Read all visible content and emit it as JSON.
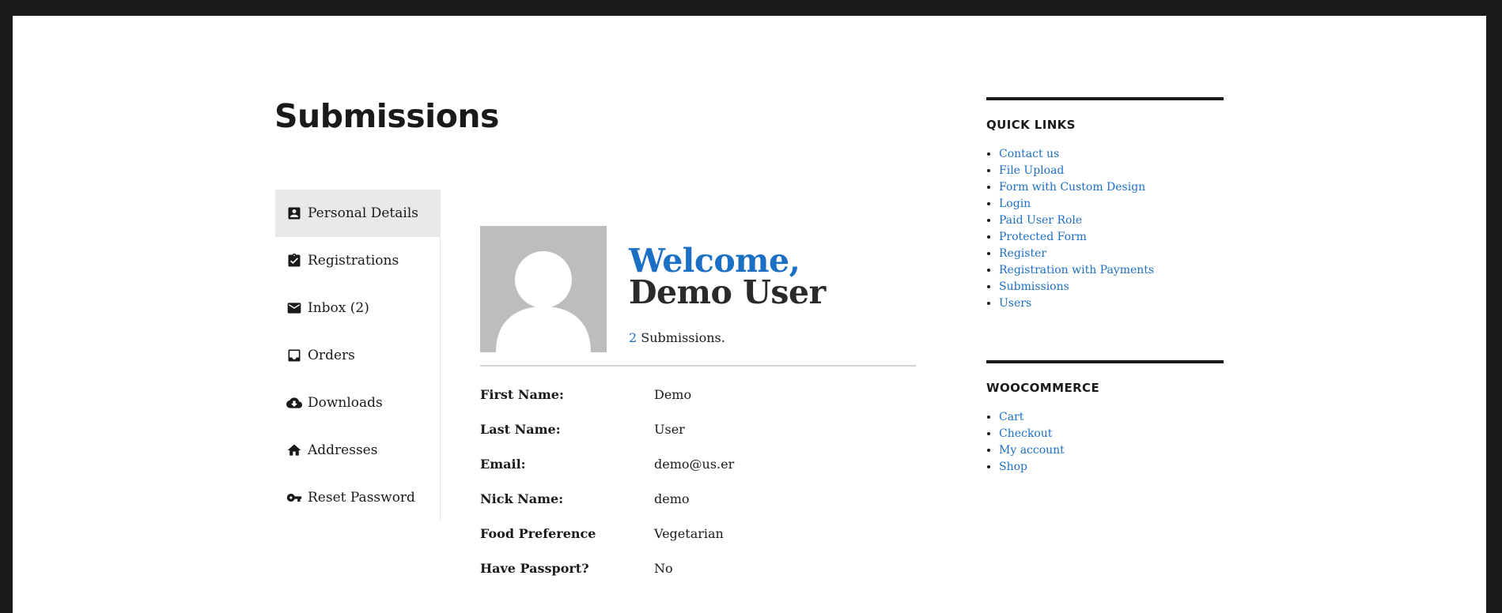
{
  "page": {
    "title": "Submissions"
  },
  "account_nav": {
    "items": [
      {
        "label": "Personal Details",
        "icon": "account-box-icon",
        "active": true
      },
      {
        "label": "Registrations",
        "icon": "clipboard-check-icon",
        "active": false
      },
      {
        "label": "Inbox (2)",
        "icon": "mail-icon",
        "active": false
      },
      {
        "label": "Orders",
        "icon": "inbox-tray-icon",
        "active": false
      },
      {
        "label": "Downloads",
        "icon": "cloud-download-icon",
        "active": false
      },
      {
        "label": "Addresses",
        "icon": "home-icon",
        "active": false
      },
      {
        "label": "Reset Password",
        "icon": "key-icon",
        "active": false
      }
    ]
  },
  "profile": {
    "welcome_prefix": "Welcome,",
    "user_name": "Demo User",
    "submissions_count": "2",
    "submissions_suffix": "Submissions.",
    "fields": [
      {
        "label": "First Name:",
        "value": "Demo"
      },
      {
        "label": "Last Name:",
        "value": "User"
      },
      {
        "label": "Email:",
        "value": "demo@us.er"
      },
      {
        "label": "Nick Name:",
        "value": "demo"
      },
      {
        "label": "Food Preference",
        "value": "Vegetarian"
      },
      {
        "label": "Have Passport?",
        "value": "No"
      }
    ]
  },
  "sidebar": {
    "quick_links": {
      "title": "QUICK LINKS",
      "links": [
        "Contact us",
        "File Upload",
        "Form with Custom Design",
        "Login",
        "Paid User Role",
        "Protected Form",
        "Register",
        "Registration with Payments",
        "Submissions",
        "Users"
      ]
    },
    "woocommerce": {
      "title": "WOOCOMMERCE",
      "links": [
        "Cart",
        "Checkout",
        "My account",
        "Shop"
      ]
    }
  },
  "colors": {
    "accent": "#1b6fc4",
    "text": "#1a1a1a",
    "frame": "#1a1a1a",
    "nav_active_bg": "#e9e9e9",
    "avatar_bg": "#bdbdbd"
  }
}
